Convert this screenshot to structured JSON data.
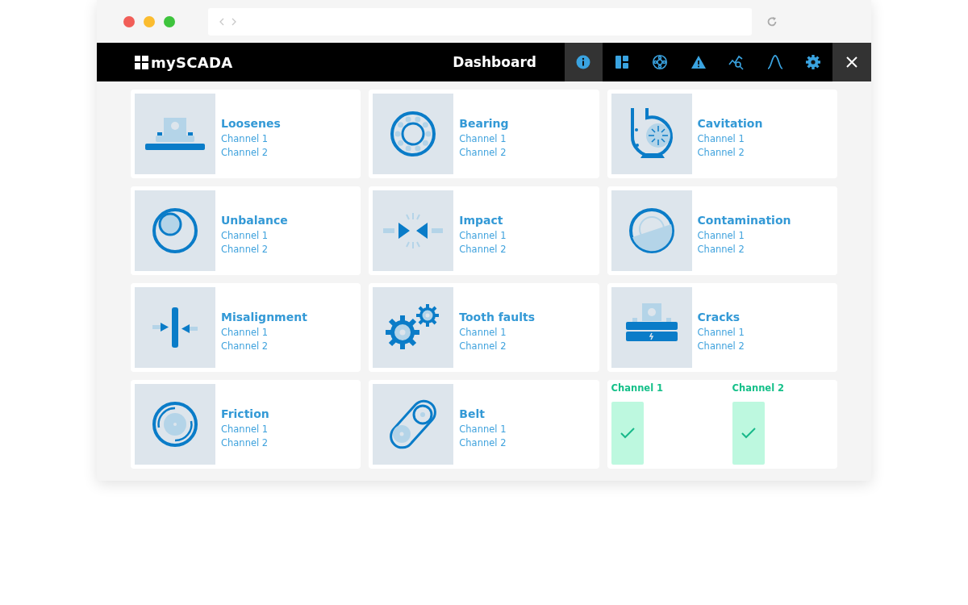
{
  "app": {
    "logo": "mySCADA",
    "title": "Dashboard"
  },
  "toolbar": [
    {
      "kind": "info",
      "selected": true
    },
    {
      "kind": "layout",
      "selected": false
    },
    {
      "kind": "bearing",
      "selected": false
    },
    {
      "kind": "warning",
      "selected": false
    },
    {
      "kind": "analysis",
      "selected": false
    },
    {
      "kind": "curve",
      "selected": false
    },
    {
      "kind": "settings",
      "selected": false
    }
  ],
  "cards": [
    {
      "kind": "loosenes",
      "title": "Loosenes",
      "channels": [
        "Channel 1",
        "Channel 2"
      ]
    },
    {
      "kind": "bearing",
      "title": "Bearing",
      "channels": [
        "Channel 1",
        "Channel 2"
      ]
    },
    {
      "kind": "cavitation",
      "title": "Cavitation",
      "channels": [
        "Channel 1",
        "Channel 2"
      ]
    },
    {
      "kind": "unbalance",
      "title": "Unbalance",
      "channels": [
        "Channel 1",
        "Channel 2"
      ]
    },
    {
      "kind": "impact",
      "title": "Impact",
      "channels": [
        "Channel 1",
        "Channel 2"
      ]
    },
    {
      "kind": "contamination",
      "title": "Contamination",
      "channels": [
        "Channel 1",
        "Channel 2"
      ]
    },
    {
      "kind": "misalignment",
      "title": "Misalignment",
      "channels": [
        "Channel 1",
        "Channel 2"
      ]
    },
    {
      "kind": "gears",
      "title": "Tooth faults",
      "channels": [
        "Channel 1",
        "Channel 2"
      ]
    },
    {
      "kind": "cracks",
      "title": "Cracks",
      "channels": [
        "Channel 1",
        "Channel 2"
      ]
    },
    {
      "kind": "friction",
      "title": "Friction",
      "channels": [
        "Channel 1",
        "Channel 2"
      ]
    },
    {
      "kind": "belt",
      "title": "Belt",
      "channels": [
        "Channel 1",
        "Channel 2"
      ]
    }
  ],
  "status": [
    {
      "label": "Channel 1",
      "ok": true
    },
    {
      "label": "Channel 2",
      "ok": true
    }
  ]
}
